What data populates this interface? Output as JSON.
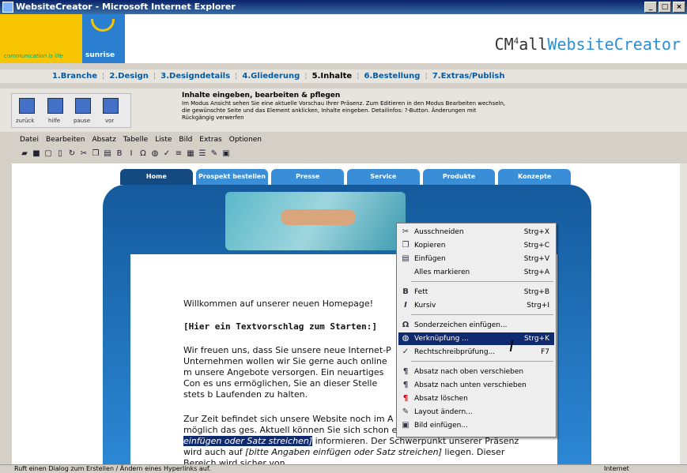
{
  "window": {
    "title": "WebsiteCreator - Microsoft Internet Explorer"
  },
  "brand": {
    "tagline": "communication is life",
    "name": "sunrise",
    "product_prefix": "CM",
    "product_sup": "4",
    "product_all": "all",
    "product_name": "WebsiteCreator"
  },
  "steps": [
    "1.Branche",
    "2.Design",
    "3.Designdetails",
    "4.Gliederung",
    "5.Inhalte",
    "6.Bestellung",
    "7.Extras/Publish"
  ],
  "active_step": "5.Inhalte",
  "nav": {
    "back": "zurück",
    "help": "hilfe",
    "pause": "pause",
    "forward": "vor"
  },
  "info": {
    "title": "Inhalte eingeben, bearbeiten & pflegen",
    "text": "Im Modus Ansicht sehen Sie eine aktuelle Vorschau Ihrer Präsenz. Zum Editieren in den Modus Bearbeiten wechseln, die gewünschte Seite und das Element anklicken, Inhalte eingeben. Detailinfos: ?-Button. Änderungen mit Rückgängig verwerfen"
  },
  "menu": [
    "Datei",
    "Bearbeiten",
    "Absatz",
    "Tabelle",
    "Liste",
    "Bild",
    "Extras",
    "Optionen"
  ],
  "site_tabs": [
    "Home",
    "Prospekt bestellen",
    "Presse",
    "Service",
    "Produkte",
    "Konzepte"
  ],
  "content": {
    "welcome": "Willkommen auf unserer neuen Homepage!",
    "heading": "[Hier ein Textvorschlag zum Starten:]",
    "para1": "Wir freuen uns, dass Sie unsere neue Internet-P Unternehmen wollen wir Sie gerne auch online m unsere Angebote versorgen. Ein neuartiges Con es uns ermöglichen, Sie an dieser Stelle stets b Laufenden zu halten.",
    "para2_a": "Zur Zeit befindet sich unsere Website noch im A bemühen, Ihnen so schnell wie möglich das ges. Aktuell können Sie sich schon einmal über ",
    "para2_hl": "[bitte Angaben einfügen oder Satz streichen]",
    "para2_b": " informieren. Der Schwerpunkt unserer Präsenz wird auch auf ",
    "para2_c": "[bitte Angaben einfügen oder Satz streichen]",
    "para2_d": " liegen. Dieser Bereich wird sicher von"
  },
  "context_menu": [
    {
      "label": "Ausschneiden",
      "shortcut": "Strg+X",
      "icon": "scissors-icon"
    },
    {
      "label": "Kopieren",
      "shortcut": "Strg+C",
      "icon": "copy-icon"
    },
    {
      "label": "Einfügen",
      "shortcut": "Strg+V",
      "icon": "paste-icon"
    },
    {
      "label": "Alles markieren",
      "shortcut": "Strg+A",
      "icon": ""
    },
    {
      "label": "Fett",
      "shortcut": "Strg+B",
      "icon": "bold-icon"
    },
    {
      "label": "Kursiv",
      "shortcut": "Strg+I",
      "icon": "italic-icon"
    },
    {
      "label": "Sonderzeichen einfügen...",
      "shortcut": "",
      "icon": "omega-icon"
    },
    {
      "label": "Verknüpfung ...",
      "shortcut": "Strg+K",
      "icon": "link-icon",
      "selected": true
    },
    {
      "label": "Rechtschreibprüfung...",
      "shortcut": "F7",
      "icon": "spellcheck-icon"
    },
    {
      "label": "Absatz nach oben verschieben",
      "shortcut": "",
      "icon": "paragraph-up-icon"
    },
    {
      "label": "Absatz nach unten verschieben",
      "shortcut": "",
      "icon": "paragraph-down-icon"
    },
    {
      "label": "Absatz löschen",
      "shortcut": "",
      "icon": "paragraph-delete-icon"
    },
    {
      "label": "Layout ändern...",
      "shortcut": "",
      "icon": "layout-icon"
    },
    {
      "label": "Bild einfügen...",
      "shortcut": "",
      "icon": "image-icon"
    }
  ],
  "status": {
    "text": "Ruft einen Dialog zum Erstellen / Ändern eines Hyperlinks auf.",
    "zone": "Internet"
  },
  "colors": {
    "titlebar": "#0a246a",
    "selection": "#102a70",
    "tab": "#3a8ed8",
    "tab_active": "#154a80",
    "brand_yellow": "#f6c400",
    "brand_blue": "#2a7fd0"
  }
}
